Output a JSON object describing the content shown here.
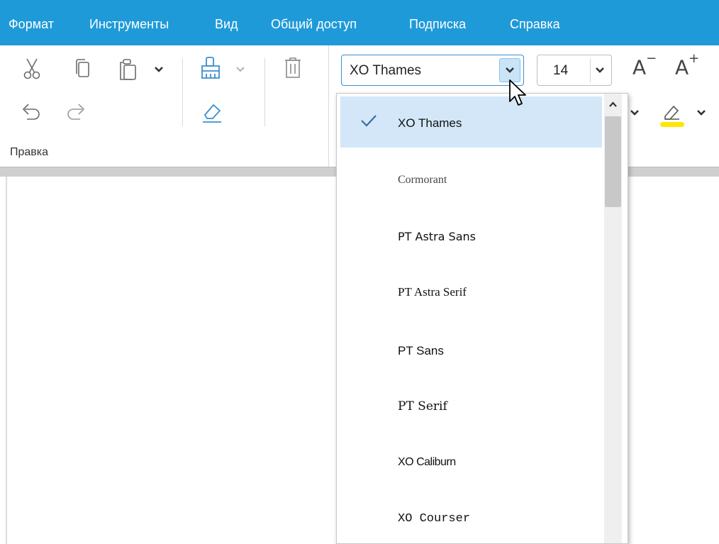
{
  "menubar": {
    "items": [
      "Формат",
      "Инструменты",
      "Вид",
      "Общий доступ",
      "Подписка",
      "Справка"
    ]
  },
  "ribbon": {
    "edit_group_label": "Правка",
    "font_name": "XO Thames",
    "font_size": "14",
    "decrease_font_label": "A",
    "increase_font_label": "A",
    "highlight_color": "#ffe600"
  },
  "font_list": {
    "selected": "XO Thames",
    "options": [
      "XO Thames",
      "Cormorant",
      "PT Astra Sans",
      "PT Astra Serif",
      "PT Sans",
      "PT Serif",
      "XO Caliburn",
      "XO Courser"
    ]
  },
  "colors": {
    "menubar_bg": "#1f9ad9",
    "selection_bg": "#d3e7f8",
    "accent": "#3a8fd0"
  }
}
